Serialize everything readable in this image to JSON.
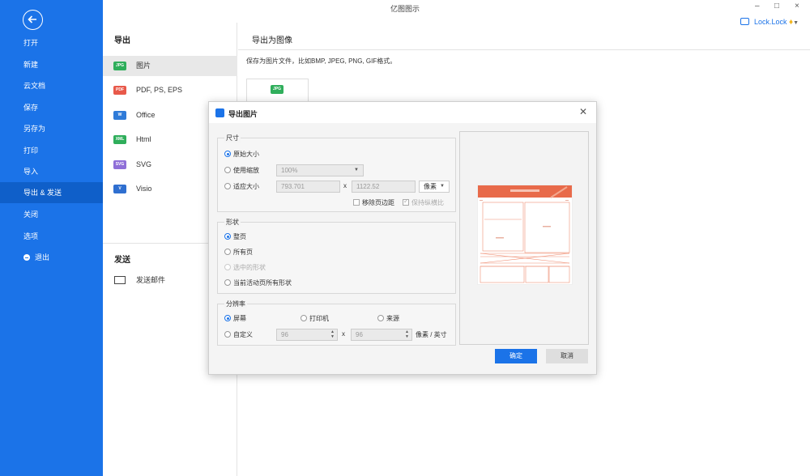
{
  "app_title": "亿图图示",
  "window_controls": {
    "minimize": "–",
    "maximize": "□",
    "close": "×"
  },
  "user": {
    "name": "Lock.Lock"
  },
  "sidebar": {
    "items": [
      {
        "label": "打开"
      },
      {
        "label": "新建"
      },
      {
        "label": "云文档"
      },
      {
        "label": "保存"
      },
      {
        "label": "另存为"
      },
      {
        "label": "打印"
      },
      {
        "label": "导入"
      },
      {
        "label": "导出 & 发送",
        "active": true
      },
      {
        "label": "关闭"
      },
      {
        "label": "选项"
      },
      {
        "label": "退出"
      }
    ]
  },
  "export_panel": {
    "title": "导出",
    "items": [
      {
        "label": "图片",
        "icon": "JPG",
        "color": "#2fae5b"
      },
      {
        "label": "PDF, PS, EPS",
        "icon": "PDF",
        "color": "#e8594a"
      },
      {
        "label": "Office",
        "icon": "W",
        "color": "#2f7bd8"
      },
      {
        "label": "Html",
        "icon": "XML",
        "color": "#2fae5b"
      },
      {
        "label": "SVG",
        "icon": "SVG",
        "color": "#8f6fd8"
      },
      {
        "label": "Visio",
        "icon": "V",
        "color": "#2f6fd0"
      }
    ],
    "send_title": "发送",
    "send_item": "发送邮件"
  },
  "right": {
    "title": "导出为图像",
    "description": "保存为图片文件，比如BMP, JPEG, PNG, GIF格式。",
    "tile_icon": "JPG"
  },
  "dialog": {
    "title": "导出图片",
    "size_group": {
      "title": "尺寸",
      "original": "原始大小",
      "use_zoom": "使用缩放",
      "zoom_value": "100%",
      "fit_size": "适应大小",
      "width": "793.701",
      "x_sep": "x",
      "height": "1122.52",
      "unit": "像素",
      "remove_margin": "移除页边距",
      "keep_ratio": "保持纵横比"
    },
    "shape_group": {
      "title": "形状",
      "whole_page": "整页",
      "all_pages": "所有页",
      "selected_shapes": "选中的形状",
      "all_shapes_active": "当前活动页所有形状"
    },
    "resolution_group": {
      "title": "分辨率",
      "screen": "屏幕",
      "printer": "打印机",
      "source": "来源",
      "custom": "自定义",
      "dpi_x": "96",
      "x_sep": "x",
      "dpi_y": "96",
      "unit": "像素 / 英寸"
    },
    "ok": "确定",
    "cancel": "取消"
  }
}
